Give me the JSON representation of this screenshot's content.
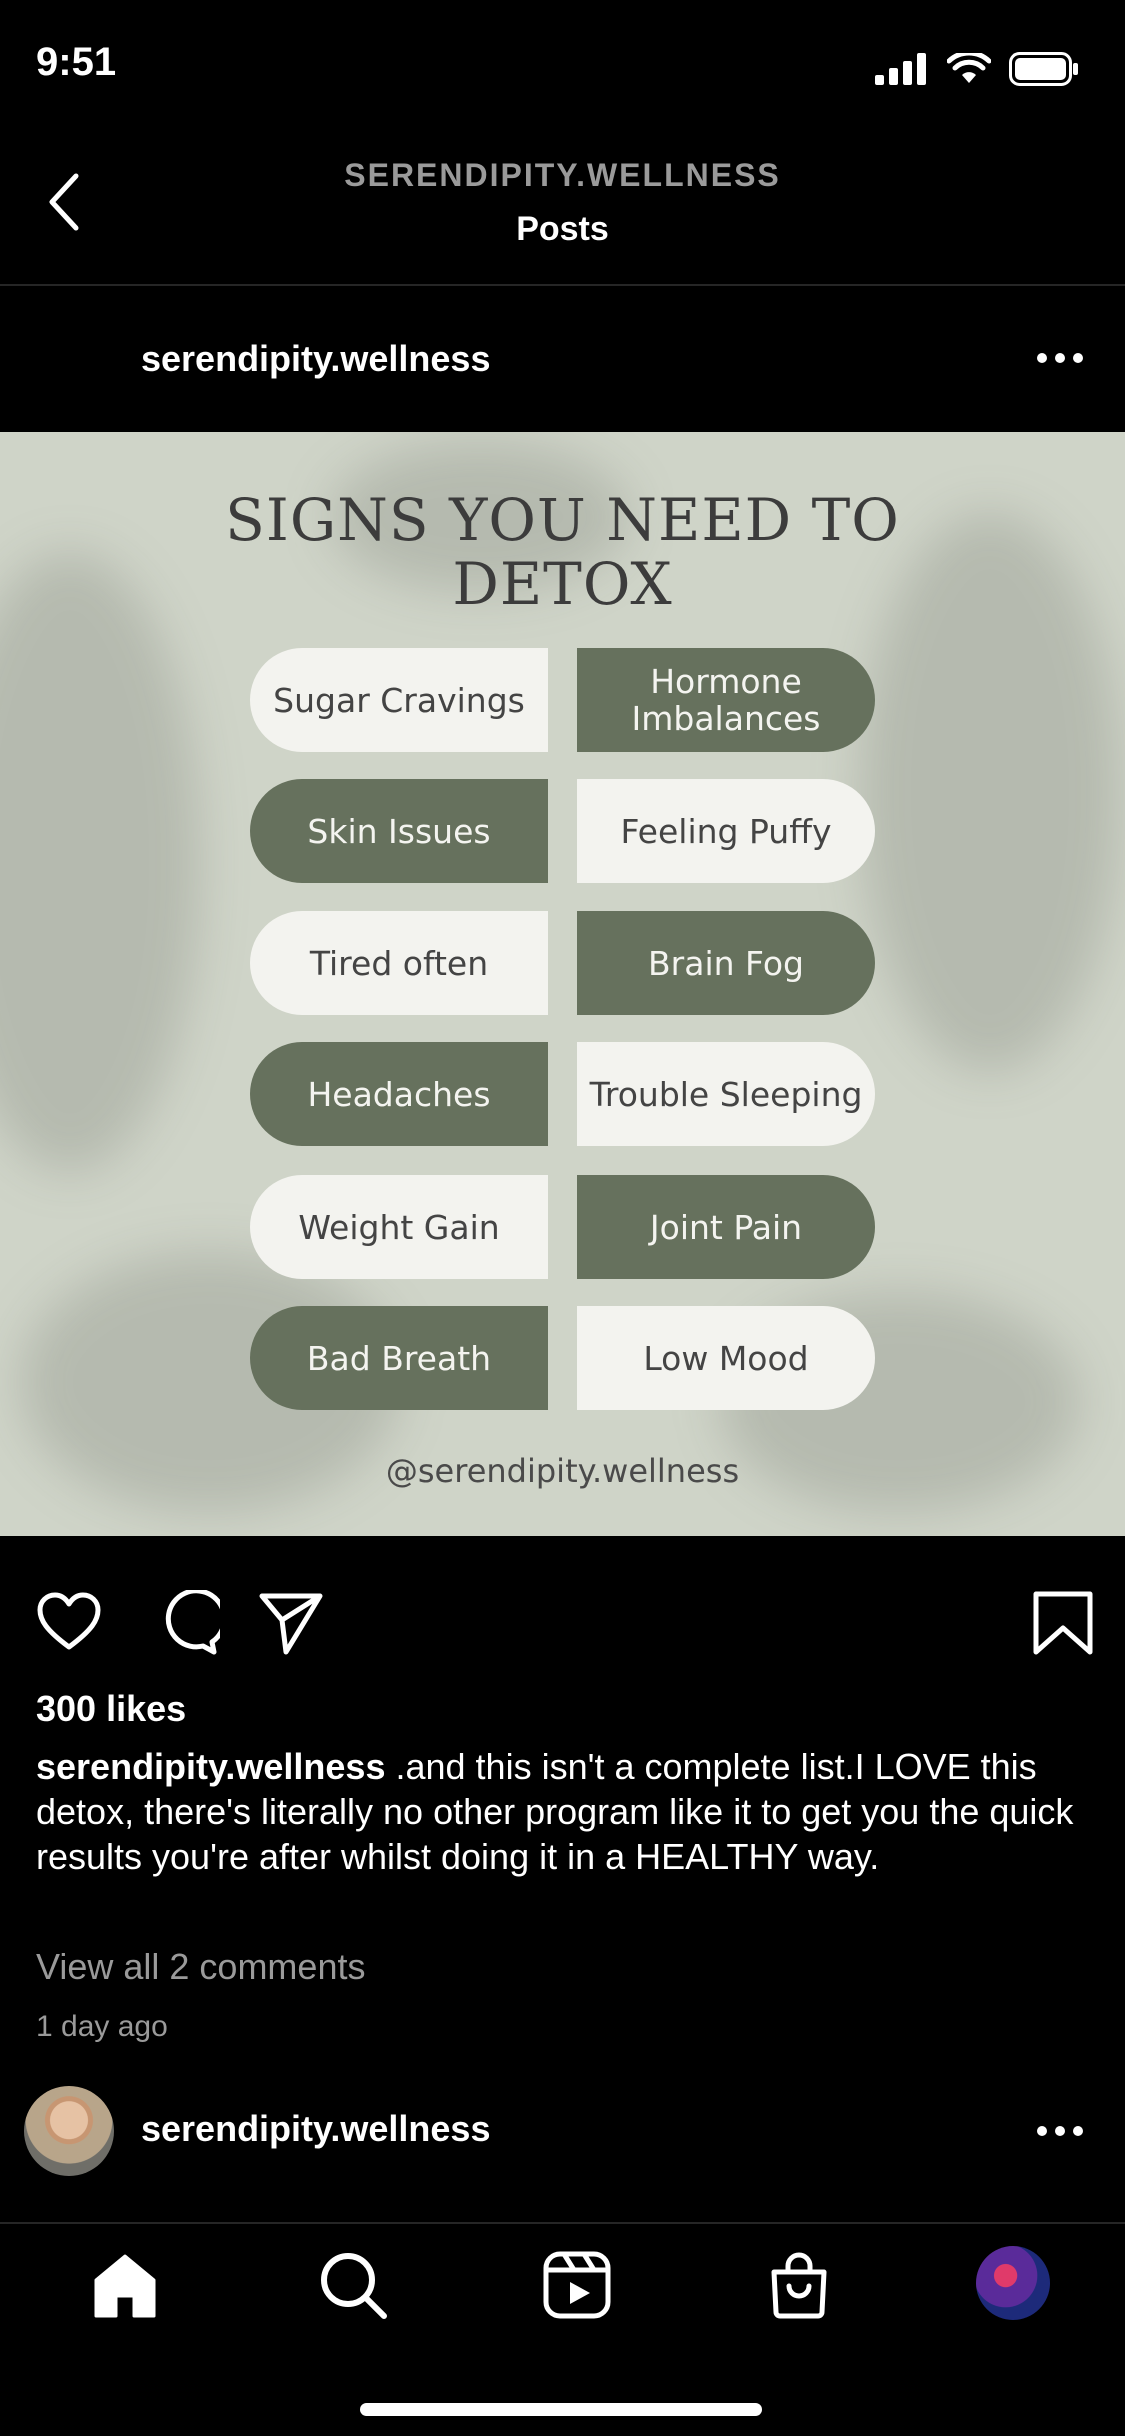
{
  "status_bar": {
    "time": "9:51"
  },
  "header": {
    "account": "SERENDIPITY.WELLNESS",
    "title": "Posts"
  },
  "post": {
    "username": "serendipity.wellness",
    "graphic": {
      "title_line1": "SIGNS YOU NEED TO",
      "title_line2": "DETOX",
      "items": [
        "Sugar Cravings",
        "Hormone Imbalances",
        "Skin Issues",
        "Feeling Puffy",
        "Tired often",
        "Brain Fog",
        "Headaches",
        "Trouble Sleeping",
        "Weight Gain",
        "Joint Pain",
        "Bad Breath",
        "Low Mood"
      ],
      "handle": "@serendipity.wellness"
    },
    "likes": "300 likes",
    "caption_user": "serendipity.wellness",
    "caption_text": " .and this isn't a complete list.I LOVE this detox, there's literally no other program like it to get you the quick results you're after whilst doing it in a HEALTHY way.",
    "view_comments": "View all 2 comments",
    "timestamp": "1 day ago"
  },
  "next_post": {
    "username": "serendipity.wellness"
  },
  "colors": {
    "pill_dark": "#66715d",
    "pill_light": "#f3f3ef",
    "image_bg": "#cfd4c8"
  },
  "icons": [
    "back-arrow-icon",
    "more-options-icon",
    "heart-icon",
    "comment-icon",
    "share-icon",
    "bookmark-icon",
    "home-icon",
    "search-icon",
    "reels-icon",
    "shop-icon"
  ]
}
